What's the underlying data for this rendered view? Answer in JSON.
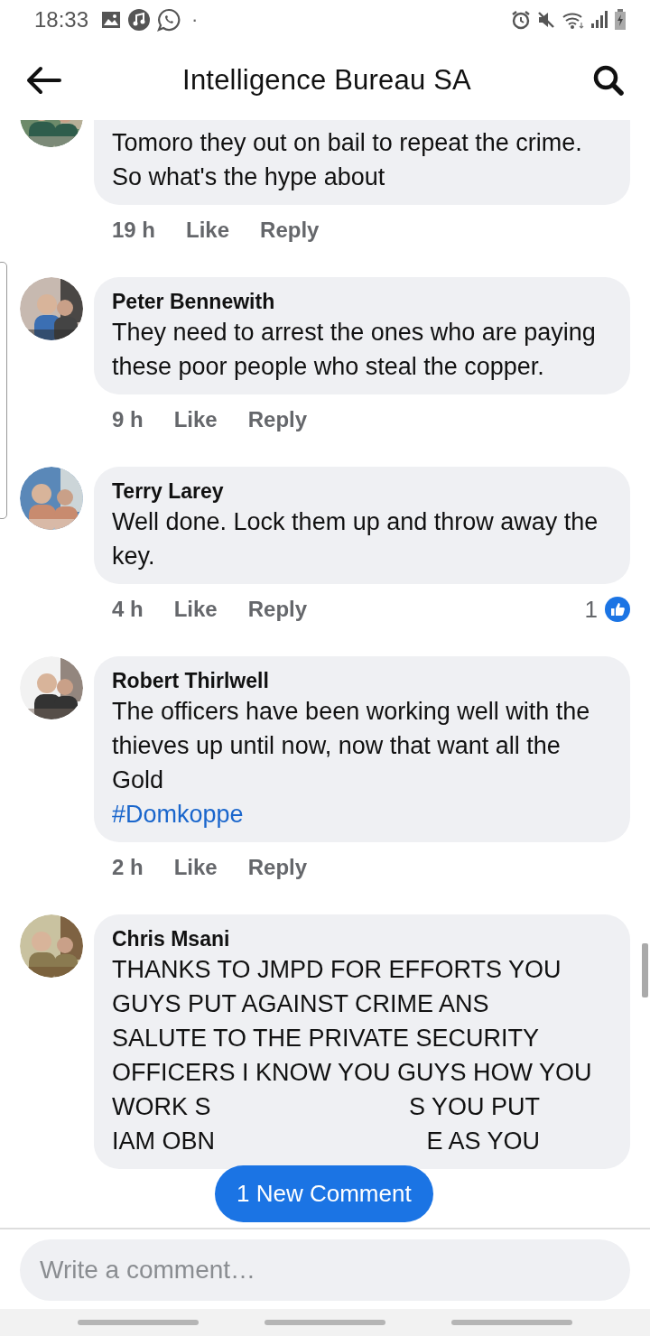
{
  "status_bar": {
    "time": "18:33",
    "dot": "·"
  },
  "header": {
    "title": "Intelligence Bureau SA"
  },
  "comments": [
    {
      "text": "Tomoro they out on bail to repeat the crime.\nSo what's the hype about",
      "time": "19 h",
      "like": "Like",
      "reply": "Reply"
    },
    {
      "author": "Peter Bennewith",
      "text": "They need to arrest the ones who are paying these poor people who steal the copper.",
      "time": "9 h",
      "like": "Like",
      "reply": "Reply"
    },
    {
      "author": "Terry Larey",
      "text": "Well done. Lock them up and throw away the key.",
      "time": "4 h",
      "like": "Like",
      "reply": "Reply",
      "reactions": "1"
    },
    {
      "author": "Robert Thirlwell",
      "text": "The officers have been working well with the thieves up until now, now that want all the Gold",
      "hashtag": "#Domkoppe",
      "time": "2 h",
      "like": "Like",
      "reply": "Reply"
    },
    {
      "author": "Chris Msani",
      "lines": [
        [
          "THANKS TO JMPD FOR EFFORTS YOU"
        ],
        [
          "GUYS PUT AGAINST CRIME ANS"
        ],
        [
          "SALUTE TO THE PRIVATE SECURITY"
        ],
        [
          "OFFICERS I KNOW YOU GUYS HOW YOU"
        ],
        [
          "WORK S",
          "S YOU PUT"
        ],
        [
          "IAM OBN",
          "E AS YOU"
        ]
      ]
    }
  ],
  "new_comment_button": "1 New Comment",
  "composer": {
    "placeholder": "Write a comment…"
  }
}
